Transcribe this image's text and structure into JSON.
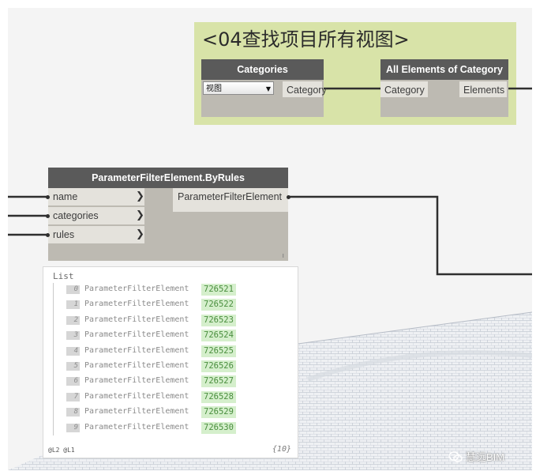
{
  "group": {
    "title": "<04查找项目所有视图>"
  },
  "nodes": {
    "categories": {
      "title": "Categories",
      "dropdown_value": "视图",
      "output": "Category"
    },
    "all_elements": {
      "title": "All Elements of Category",
      "input": "Category",
      "output": "Elements"
    },
    "byrules": {
      "title": "ParameterFilterElement.ByRules",
      "inputs": [
        "name",
        "categories",
        "rules"
      ],
      "output": "ParameterFilterElement",
      "resize_mark": "ı"
    }
  },
  "list_panel": {
    "title": "List",
    "rows": [
      {
        "index": "0",
        "type": "ParameterFilterElement",
        "value": "726521"
      },
      {
        "index": "1",
        "type": "ParameterFilterElement",
        "value": "726522"
      },
      {
        "index": "2",
        "type": "ParameterFilterElement",
        "value": "726523"
      },
      {
        "index": "3",
        "type": "ParameterFilterElement",
        "value": "726524"
      },
      {
        "index": "4",
        "type": "ParameterFilterElement",
        "value": "726525"
      },
      {
        "index": "5",
        "type": "ParameterFilterElement",
        "value": "726526"
      },
      {
        "index": "6",
        "type": "ParameterFilterElement",
        "value": "726527"
      },
      {
        "index": "7",
        "type": "ParameterFilterElement",
        "value": "726528"
      },
      {
        "index": "8",
        "type": "ParameterFilterElement",
        "value": "726529"
      },
      {
        "index": "9",
        "type": "ParameterFilterElement",
        "value": "726530"
      }
    ],
    "levels": "@L2 @L1",
    "count": "{10}"
  },
  "watermark": {
    "text": "慧远BIM",
    "icon": "wechat-icon"
  },
  "colors": {
    "group_bg": "#d8e3a8",
    "node_header": "#5a5a5a",
    "node_body": "#bdbab2",
    "value_bg": "#d5efcc",
    "value_text": "#4a8e3e",
    "wire": "#2f2f2f"
  }
}
